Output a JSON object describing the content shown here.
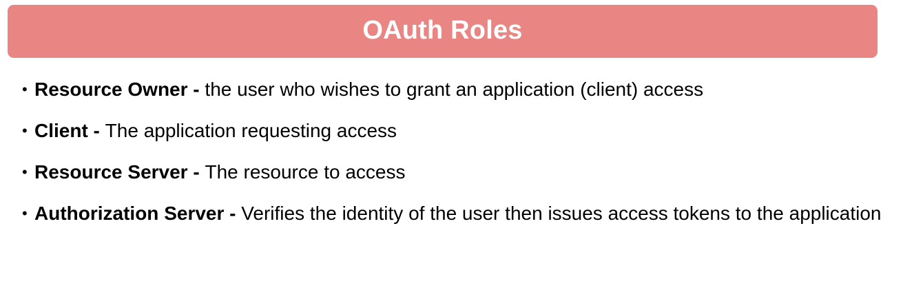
{
  "header": {
    "title": "OAuth Roles",
    "background_color": "#e98583",
    "text_color": "#ffffff"
  },
  "bullet_glyph": "•",
  "roles": [
    {
      "name": "Resource Owner",
      "separator": " - ",
      "description": "the user who wishes to grant an application (client) access"
    },
    {
      "name": "Client",
      "separator": " - ",
      "description": "The application requesting access"
    },
    {
      "name": "Resource Server",
      "separator": " - ",
      "description": "The resource to access"
    },
    {
      "name": "Authorization Server",
      "separator": " - ",
      "description": "Verifies the identity of the user then issues access tokens to the application"
    }
  ]
}
